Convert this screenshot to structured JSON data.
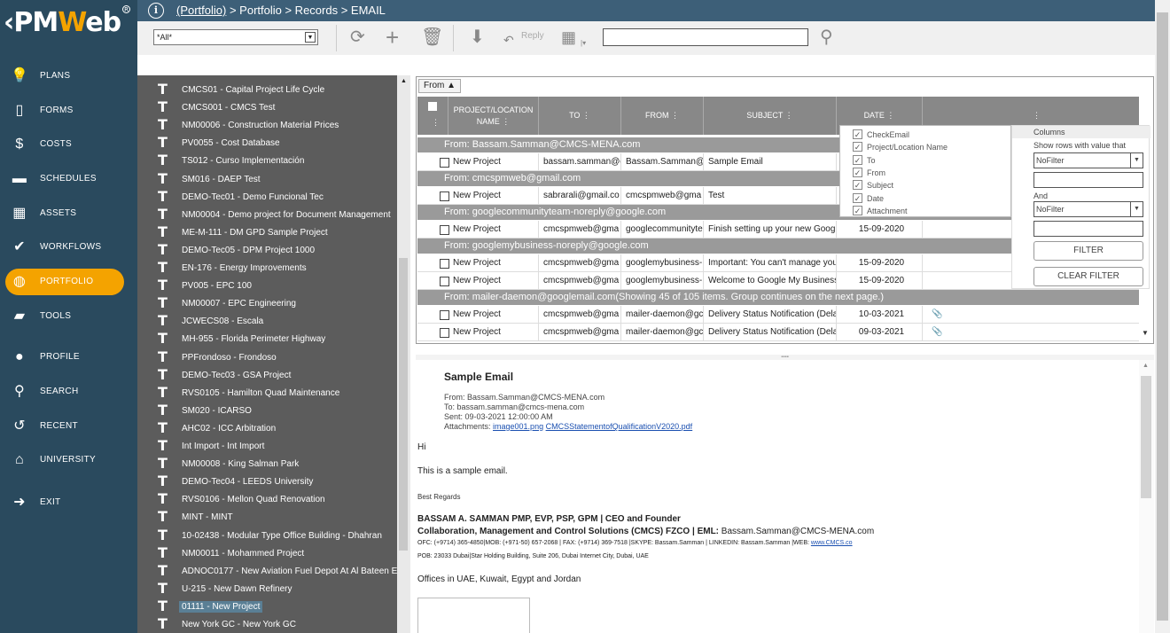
{
  "app": {
    "logo_prefix": "‹PM",
    "logo_w": "W",
    "logo_suffix": "eb",
    "reg": "R"
  },
  "nav": [
    {
      "label": "PLANS",
      "icon": "lightbulb-icon",
      "glyph": "💡"
    },
    {
      "label": "FORMS",
      "icon": "document-icon",
      "glyph": "▯"
    },
    {
      "label": "COSTS",
      "icon": "dollar-icon",
      "glyph": "$"
    },
    {
      "label": "SCHEDULES",
      "icon": "schedule-bars-icon",
      "glyph": "▬"
    },
    {
      "label": "ASSETS",
      "icon": "building-icon",
      "glyph": "▦"
    },
    {
      "label": "WORKFLOWS",
      "icon": "checkmark-icon",
      "glyph": "✔"
    },
    {
      "label": "PORTFOLIO",
      "icon": "globe-icon",
      "glyph": "◍"
    },
    {
      "label": "TOOLS",
      "icon": "toolbox-icon",
      "glyph": "▰"
    },
    {
      "label": "PROFILE",
      "icon": "avatar-icon",
      "glyph": "●"
    },
    {
      "label": "SEARCH",
      "icon": "search-icon",
      "glyph": "⚲"
    },
    {
      "label": "RECENT",
      "icon": "history-icon",
      "glyph": "↺"
    },
    {
      "label": "UNIVERSITY",
      "icon": "graduation-cap-icon",
      "glyph": "⌂"
    },
    {
      "label": "EXIT",
      "icon": "exit-icon",
      "glyph": "➜"
    }
  ],
  "breadcrumb": {
    "link": "(Portfolio)",
    "rest": " > Portfolio > Records > EMAIL",
    "info": "i"
  },
  "toolbar": {
    "selected": "*All*",
    "reply": "Reply",
    "search_value": ""
  },
  "tree": [
    "CMCS01 - Capital Project Life Cycle",
    "CMCS001 - CMCS Test",
    "NM00006 - Construction Material Prices",
    "PV0055 - Cost Database",
    "TS012 - Curso Implementación",
    "SM016 - DAEP Test",
    "DEMO-Tec01 - Demo Funcional Tec",
    "NM00004 - Demo project for Document Management",
    "ME-M-111 - DM GPD Sample Project",
    "DEMO-Tec05 - DPM Project 1000",
    "EN-176 - Energy Improvements",
    "PV005 - EPC 100",
    "NM00007 - EPC Engineering",
    "JCWECS08 - Escala",
    "MH-955 - Florida Perimeter Highway",
    "PPFrondoso - Frondoso",
    "DEMO-Tec03 - GSA Project",
    "RVS0105 - Hamilton Quad Maintenance",
    "SM020 - ICARSO",
    "AHC02 - ICC Arbitration",
    "Int Import - Int Import",
    "NM00008 - King Salman Park",
    "DEMO-Tec04 - LEEDS University",
    "RVS0106 - Mellon Quad Renovation",
    "MINT - MINT",
    "10-02438 - Modular Type Office Building - Dhahran",
    "NM00011 - Mohammed Project",
    "ADNOC0177 - New Aviation Fuel Depot At Al Bateen E",
    "U-215 - New Dawn Refinery",
    "01111 - New Project",
    "New York GC - New York GC"
  ],
  "grid": {
    "group_by": "From",
    "columns": [
      "PROJECT/LOCATION NAME",
      "TO",
      "FROM",
      "SUBJECT",
      "DATE"
    ],
    "groups": [
      {
        "label": "From: Bassam.Samman@CMCS-MENA.com",
        "rows": [
          {
            "project": "New Project",
            "to": "bassam.samman@c",
            "from": "Bassam.Samman@",
            "subject": "Sample Email",
            "date": ""
          }
        ]
      },
      {
        "label": "From: cmcspmweb@gmail.com",
        "rows": [
          {
            "project": "New Project",
            "to": "sabrarali@gmail.co",
            "from": "cmcspmweb@gma",
            "subject": "Test",
            "date": ""
          }
        ]
      },
      {
        "label": "From: googlecommunityteam-noreply@google.com",
        "rows": [
          {
            "project": "New Project",
            "to": "cmcspmweb@gma",
            "from": "googlecommunityte",
            "subject": "Finish setting up your new Googl",
            "date": "15-09-2020"
          }
        ]
      },
      {
        "label": "From: googlemybusiness-noreply@google.com",
        "rows": [
          {
            "project": "New Project",
            "to": "cmcspmweb@gma",
            "from": "googlemybusiness-",
            "subject": "Important: You can't manage you",
            "date": "15-09-2020"
          },
          {
            "project": "New Project",
            "to": "cmcspmweb@gma",
            "from": "googlemybusiness-",
            "subject": "Welcome to Google My Business",
            "date": "15-09-2020"
          }
        ]
      },
      {
        "label": "From: mailer-daemon@googlemail.com(Showing 45 of 105 items. Group continues on the next page.)",
        "rows": [
          {
            "project": "New Project",
            "to": "cmcspmweb@gma",
            "from": "mailer-daemon@gc",
            "subject": "Delivery Status Notification (Dela",
            "date": "10-03-2021",
            "attach": "📎"
          },
          {
            "project": "New Project",
            "to": "cmcspmweb@gma",
            "from": "mailer-daemon@gc",
            "subject": "Delivery Status Notification (Dela",
            "date": "09-03-2021",
            "attach": "📎"
          }
        ]
      }
    ]
  },
  "column_menu": {
    "items": [
      "CheckEmail",
      "Project/Location Name",
      "To",
      "From",
      "Subject",
      "Date",
      "Attachment"
    ]
  },
  "filter": {
    "title": "Columns",
    "show_rows": "Show rows with value that",
    "op1": "NoFilter",
    "and": "And",
    "op2": "NoFilter",
    "filter_btn": "FILTER",
    "clear_btn": "CLEAR FILTER"
  },
  "preview": {
    "subject": "Sample Email",
    "from": "From: Bassam.Samman@CMCS-MENA.com",
    "to": "To: bassam.samman@cmcs-mena.com",
    "sent": "Sent: 09-03-2021 12:00:00 AM",
    "attach_label": "Attachments: ",
    "attach1": "image001.png",
    "attach2": "CMCSStatementofQualificationV2020.pdf",
    "hi": "Hi",
    "body": "This is a sample email.",
    "regards": "Best Regards",
    "sig1a": "BASSAM A. SAMMAN PMP, EVP, PSP, GPM | CEO and Founder",
    "sig2a": "Collaboration, Management and Control Solutions (CMCS) FZCO | EML: ",
    "sig2b": "Bassam.Samman@CMCS-MENA.com",
    "sig3": "OFC: (+9714) 365-4850|MOB: (+971-50) 657-2068 | FAX: (+9714) 369-7518 |SKYPE: Bassam.Samman | LINKEDIN: Bassam.Samman |WEB: ",
    "sig3link": "www.CMCS.co",
    "sig4": "POB: 23033 Dubai|Star Holding Building, Suite 206, Dubai Internet City, Dubai, UAE",
    "offices": "Offices in UAE, Kuwait, Egypt and Jordan"
  }
}
